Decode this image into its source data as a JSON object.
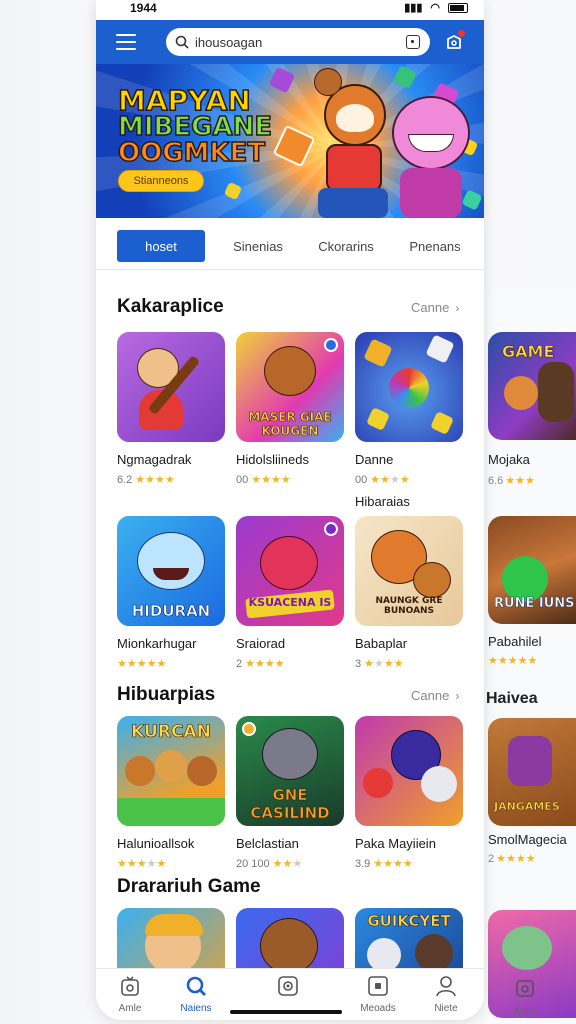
{
  "status_bar": {
    "time": "1944",
    "icons": [
      "signal-icon",
      "wifi-icon",
      "battery-icon"
    ]
  },
  "app_bar": {
    "search_value": "ihousoagan",
    "icons": [
      "menu-icon",
      "search-icon",
      "scan-icon",
      "notification-icon"
    ]
  },
  "banner": {
    "line1": "MAPYAN",
    "line2": "MIBEGANE",
    "line3": "OOGMKET",
    "button": "Stianneons"
  },
  "tabs": [
    {
      "label": "hoset",
      "active": true
    },
    {
      "label": "Sinenias",
      "active": false
    },
    {
      "label": "Ckorarins",
      "active": false
    },
    {
      "label": "Pnenans",
      "active": false
    }
  ],
  "sections": [
    {
      "title": "Kakaraplice",
      "link": "Canne",
      "rows": [
        [
          {
            "name": "Ngmagadrak",
            "rating": "6.2",
            "label": ""
          },
          {
            "name": "Hidolsliineds",
            "rating": "00",
            "label": "MASER GIAE KOUGEN"
          },
          {
            "name": "Danne",
            "rating": "00",
            "label": "",
            "extra": "Hibaraias"
          }
        ],
        [
          {
            "name": "Mionkarhugar",
            "rating": "",
            "label": "HIDURAN"
          },
          {
            "name": "Sraiorad",
            "rating": "2",
            "label": "KSUACENA IS"
          },
          {
            "name": "Babaplar",
            "rating": "3",
            "label": "NAUNGK GRE BUNOANS"
          }
        ]
      ]
    },
    {
      "title": "Hibuarpias",
      "link": "Canne",
      "rows": [
        [
          {
            "name": "Halunioallsok",
            "rating": "",
            "label": "KURCAN"
          },
          {
            "name": "Belclastian",
            "rating": "20 100",
            "label": "GNE CASILIND"
          },
          {
            "name": "Paka Mayiiein",
            "rating": "3.9",
            "label": ""
          }
        ]
      ]
    },
    {
      "title": "Drarariuh Game",
      "rows": [
        [
          {
            "label": ""
          },
          {
            "label": ""
          },
          {
            "label": "GUIKCYET"
          }
        ]
      ]
    }
  ],
  "ghost_column": {
    "items": [
      {
        "name": "Mojaka",
        "rating": "6.6",
        "label": "GAME"
      },
      {
        "name": "Pabahilel",
        "rating": "",
        "label": "RUNE IUNS"
      },
      {
        "name": "SmolMagecia",
        "rating": "2",
        "label": "JANGAMES"
      }
    ],
    "section_title": "Haivea"
  },
  "bottom_nav": [
    {
      "label": "Amle",
      "icon": "home-icon",
      "active": false
    },
    {
      "label": "Naiens",
      "icon": "search-icon",
      "active": true
    },
    {
      "label": "",
      "icon": "games-icon",
      "active": false
    },
    {
      "label": "Meoads",
      "icon": "apps-icon",
      "active": false
    },
    {
      "label": "Niete",
      "icon": "profile-icon",
      "active": false
    }
  ],
  "colors": {
    "primary": "#1c5fcf",
    "star": "#f3b61f",
    "banner_button": "#ffc61a"
  }
}
